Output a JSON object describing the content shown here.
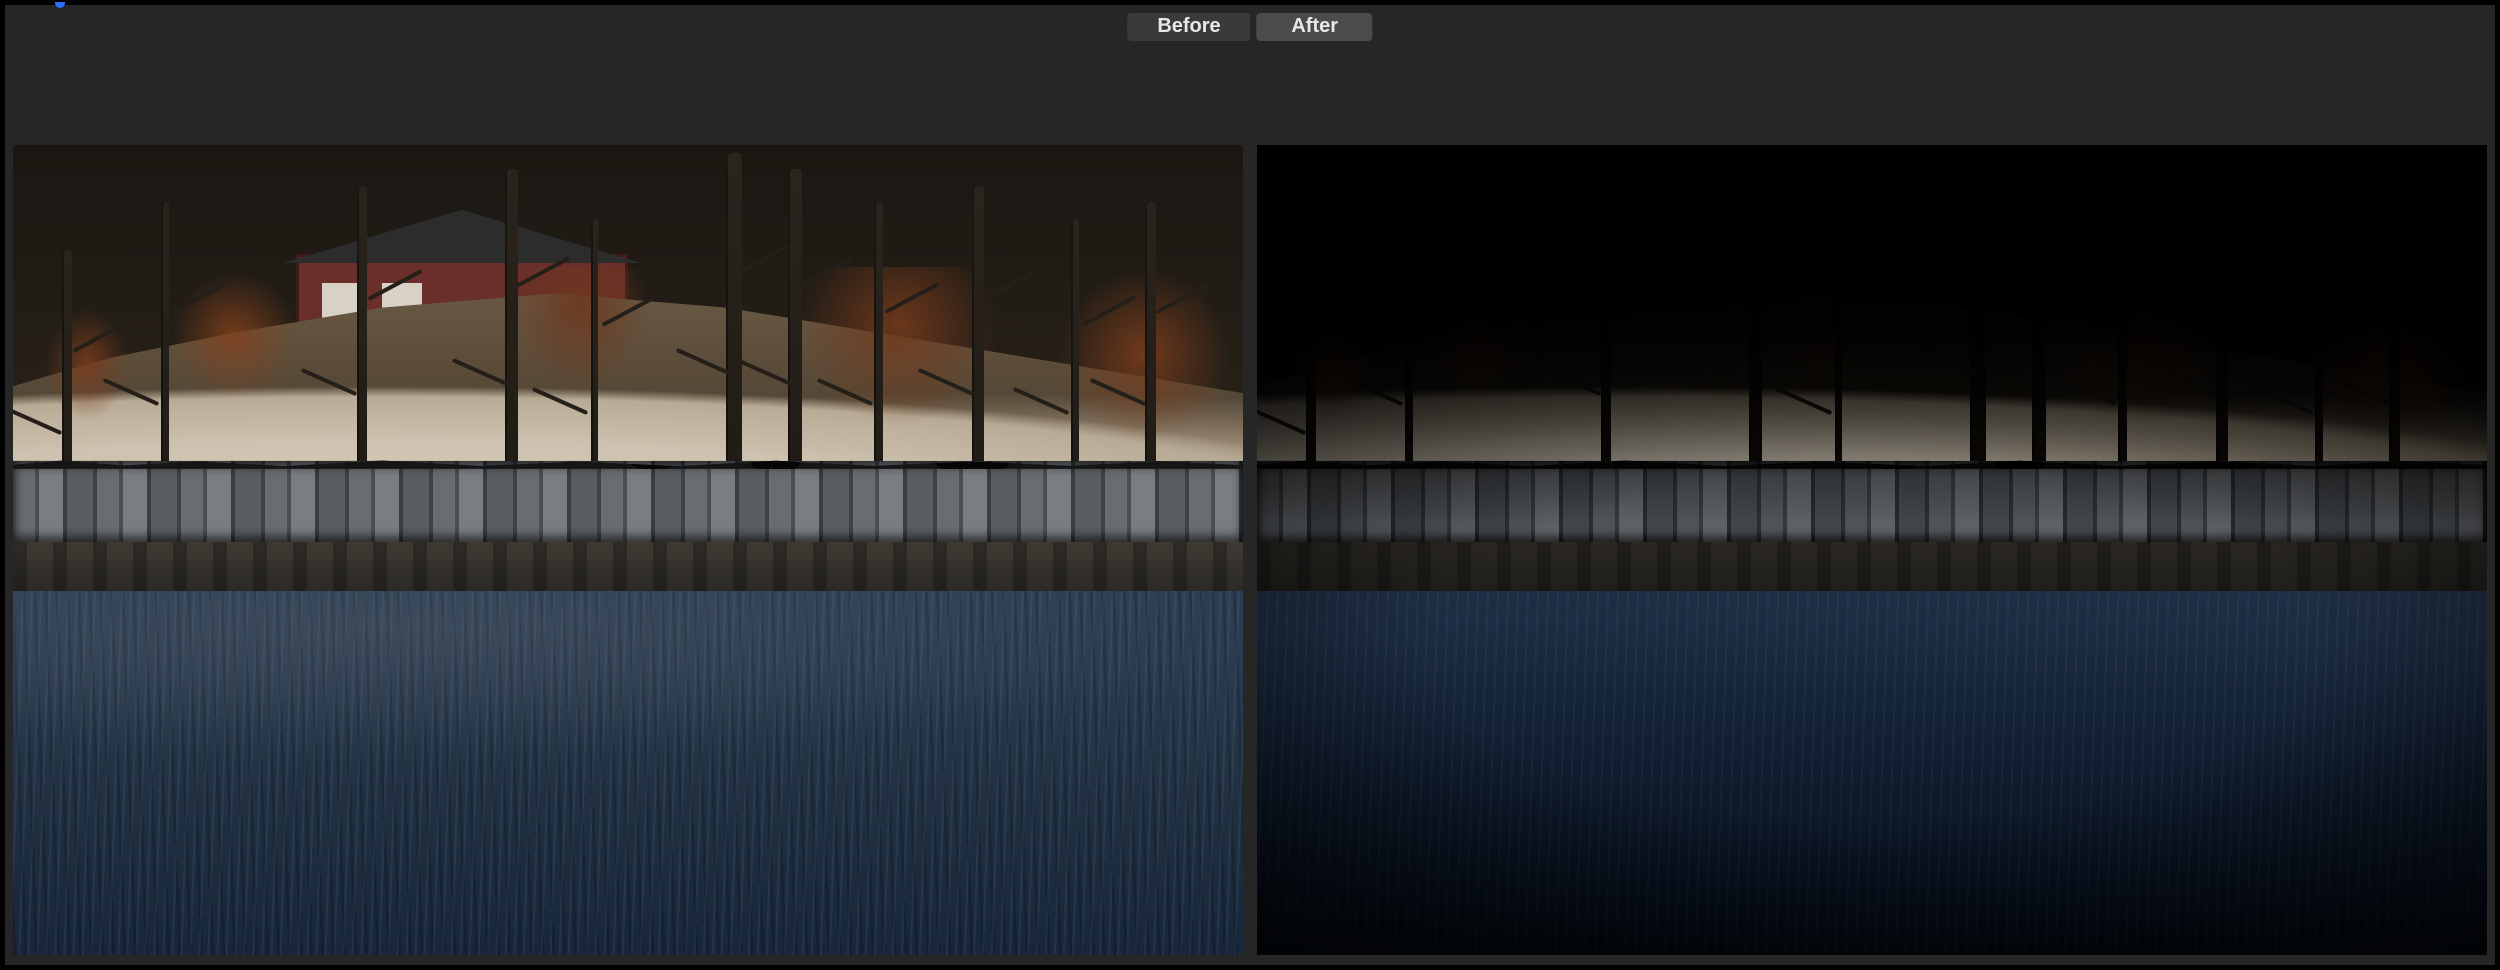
{
  "compare": {
    "before_label": "Before",
    "after_label": "After",
    "active": "after"
  }
}
